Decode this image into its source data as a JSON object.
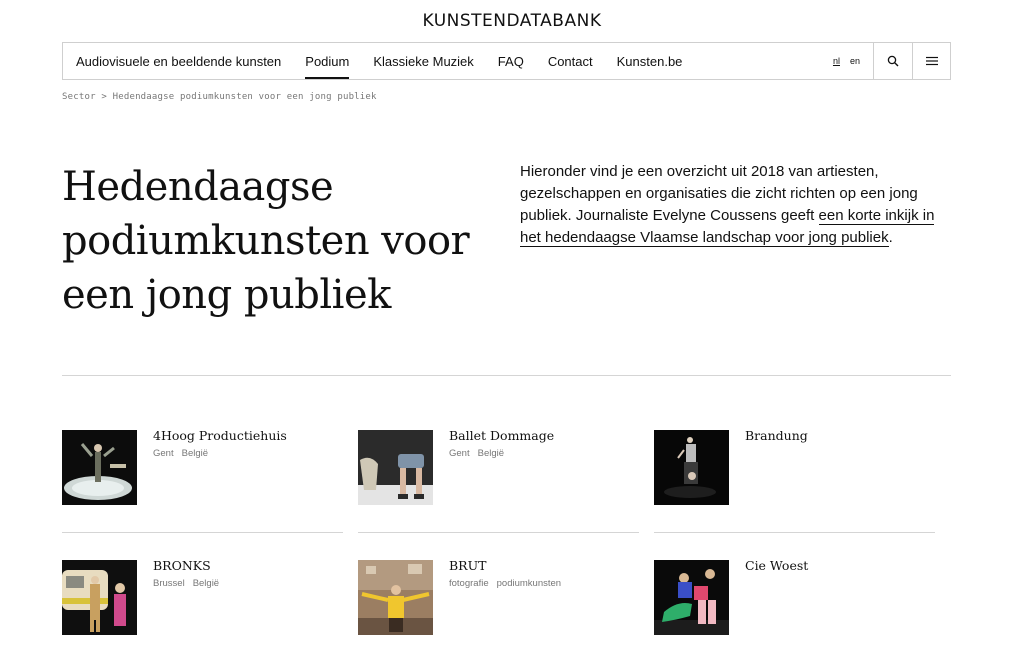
{
  "site": {
    "logo": "KUNSTENDATABANK"
  },
  "nav": {
    "links": [
      "Audiovisuele en beeldende kunsten",
      "Podium",
      "Klassieke Muziek",
      "FAQ",
      "Contact",
      "Kunsten.be"
    ],
    "active": "Podium",
    "lang_current": "nl",
    "lang_other": "en",
    "icons": {
      "search": "search-icon",
      "menu": "hamburger-menu-icon"
    }
  },
  "breadcrumb": {
    "root": "Sector",
    "separator": ">",
    "current": "Hedendaagse podiumkunsten voor een jong publiek"
  },
  "hero": {
    "title": "Hedendaagse podiumkunsten voor een jong publiek",
    "intro_text": "Hieronder vind je een overzicht uit 2018 van artiesten, gezelschappen en organisaties die zicht richten op een jong publiek. Journaliste Evelyne Coussens geeft ",
    "intro_link": "een korte inkijk in het hedendaagse Vlaamse landschap voor jong publiek",
    "intro_end": "."
  },
  "cards": [
    {
      "name": "4Hoog Productiehuis",
      "tags": [
        "Gent",
        "België"
      ]
    },
    {
      "name": "Ballet Dommage",
      "tags": [
        "Gent",
        "België"
      ]
    },
    {
      "name": "Brandung",
      "tags": []
    },
    {
      "name": "BRONKS",
      "tags": [
        "Brussel",
        "België"
      ]
    },
    {
      "name": "BRUT",
      "tags": [
        "fotografie",
        "podiumkunsten"
      ]
    },
    {
      "name": "Cie Woest",
      "tags": []
    }
  ],
  "colors": {
    "text": "#111111",
    "muted": "#777777",
    "border": "#cfcfcf",
    "background": "#ffffff"
  }
}
